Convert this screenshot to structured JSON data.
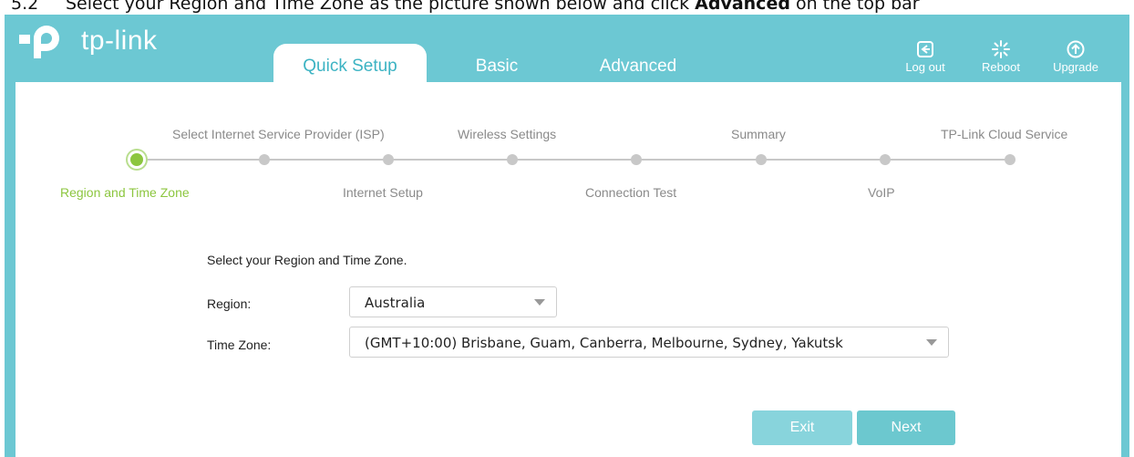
{
  "doc": {
    "number": "5.2",
    "text_prefix": "Select your Region and Time Zone as the picture shown below and click ",
    "text_bold": "Advanced",
    "text_suffix": " on the top bar"
  },
  "logo": {
    "text": "tp-link"
  },
  "tabs": [
    {
      "label": "Quick Setup",
      "active": true
    },
    {
      "label": "Basic",
      "active": false
    },
    {
      "label": "Advanced",
      "active": false
    }
  ],
  "top_actions": [
    {
      "label": "Log out",
      "icon": "log-out-icon"
    },
    {
      "label": "Reboot",
      "icon": "reboot-icon"
    },
    {
      "label": "Upgrade",
      "icon": "upgrade-icon"
    }
  ],
  "steps": {
    "top": [
      "Select Internet Service Provider (ISP)",
      "Wireless Settings",
      "Summary",
      "TP-Link Cloud Service"
    ],
    "bottom": [
      "Region and Time Zone",
      "Internet Setup",
      "Connection Test",
      "VoIP"
    ],
    "active_step": 1
  },
  "form": {
    "title": "Select your Region and Time Zone.",
    "region_label": "Region:",
    "region_value": "Australia",
    "timezone_label": "Time Zone:",
    "timezone_value": "(GMT+10:00) Brisbane, Guam, Canberra, Melbourne, Sydney, Yakutsk"
  },
  "buttons": {
    "exit": "Exit",
    "next": "Next"
  },
  "colors": {
    "brand": "#6cc8d3",
    "active_step": "#8cc63f",
    "tab_text_active": "#3cb3c3"
  }
}
